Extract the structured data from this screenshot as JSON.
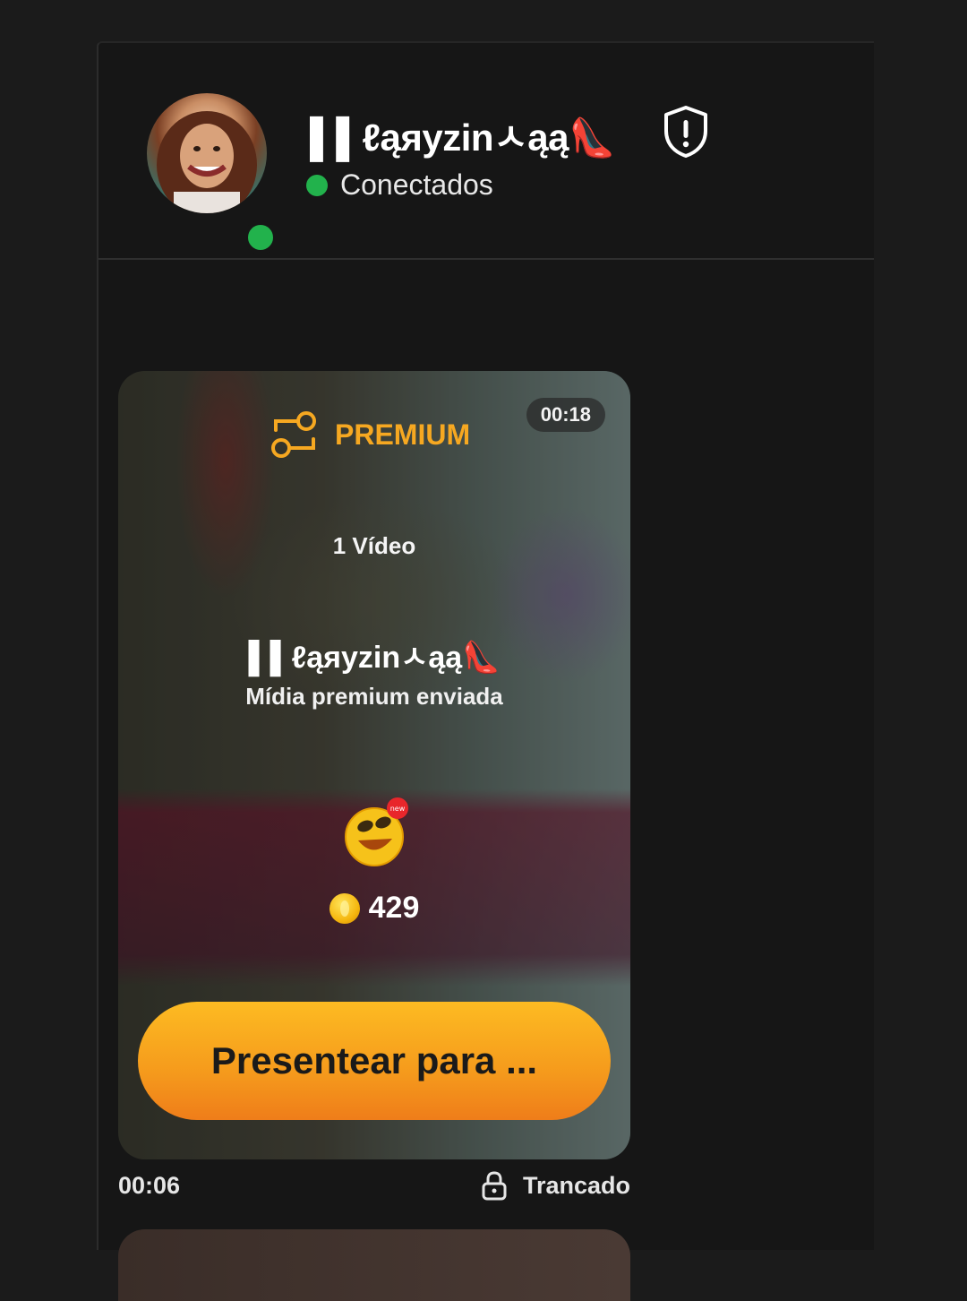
{
  "header": {
    "contact_name": "▌▌ℓąяyzinㅅąą👠",
    "status_text": "Conectados",
    "status_color": "#22b24c",
    "avatar_alt": "avatar"
  },
  "message": {
    "duration": "00:18",
    "premium_label": "PREMIUM",
    "video_count": "1 Vídeo",
    "sender_name": "▌▌ℓąяyzinㅅąą👠",
    "subtitle": "Mídia premium enviada",
    "gift_badge": "new",
    "price": "429",
    "button_label": "Presentear para ...",
    "sent_time": "00:06",
    "lock_status": "Trancado",
    "accent_color": "#f6a821"
  }
}
